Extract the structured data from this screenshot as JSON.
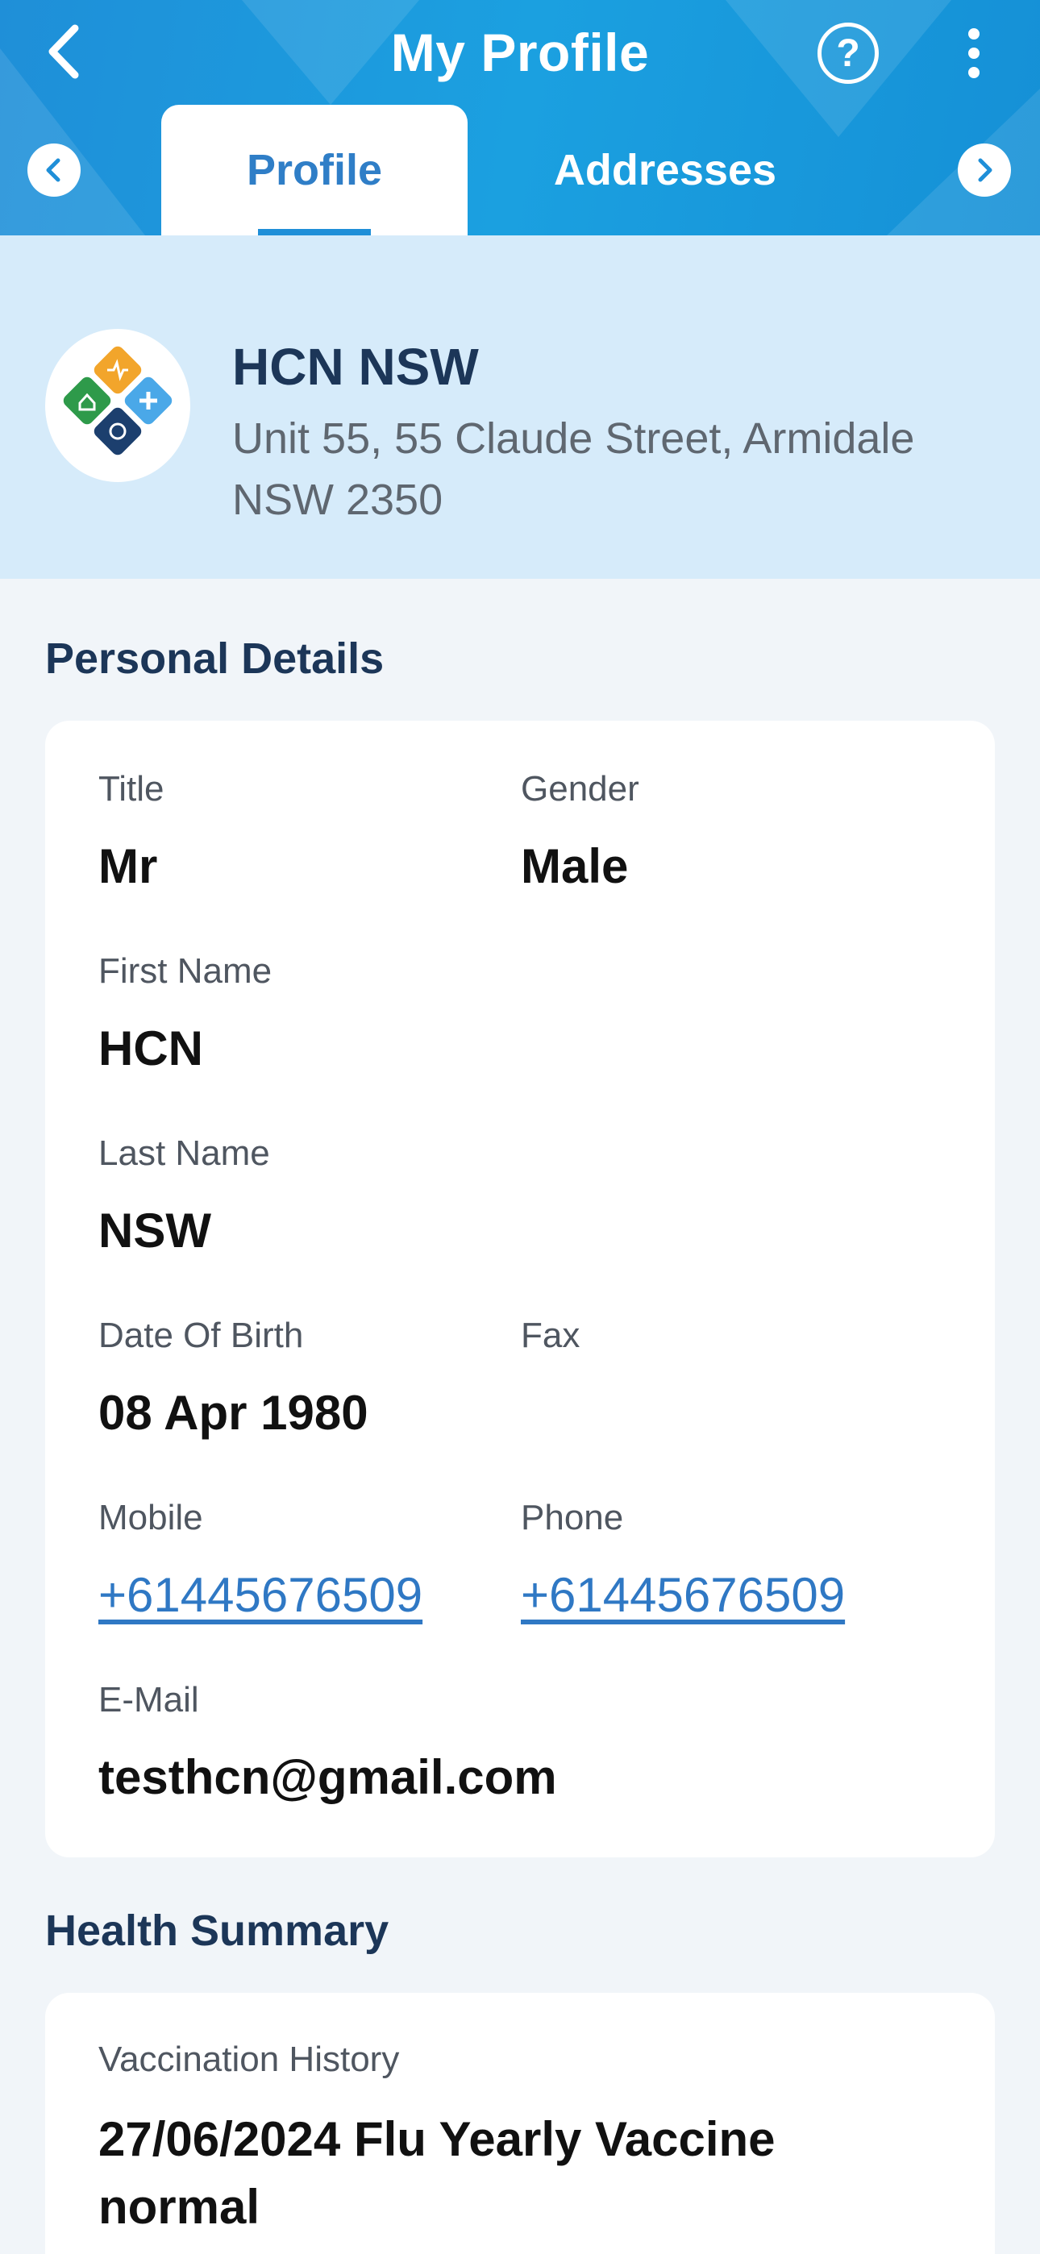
{
  "header": {
    "title": "My Profile",
    "help_label": "?",
    "tabs": [
      {
        "label": "Profile",
        "active": true
      },
      {
        "label": "Addresses",
        "active": false
      }
    ]
  },
  "icons": {
    "back": "chevron-left-icon",
    "help": "help-circle-icon",
    "more": "more-vertical-icon",
    "tab_prev": "chevron-left-icon",
    "tab_next": "chevron-right-icon"
  },
  "organisation": {
    "name": "HCN NSW",
    "address": "Unit 55, 55 Claude Street, Armidale NSW 2350"
  },
  "personal_details": {
    "section_title": "Personal Details",
    "title": {
      "label": "Title",
      "value": "Mr"
    },
    "gender": {
      "label": "Gender",
      "value": "Male"
    },
    "first_name": {
      "label": "First Name",
      "value": "HCN"
    },
    "last_name": {
      "label": "Last Name",
      "value": "NSW"
    },
    "dob": {
      "label": "Date Of Birth",
      "value": "08 Apr 1980"
    },
    "fax": {
      "label": "Fax",
      "value": ""
    },
    "mobile": {
      "label": "Mobile",
      "value": "+61445676509"
    },
    "phone": {
      "label": "Phone",
      "value": "+61445676509"
    },
    "email": {
      "label": "E-Mail",
      "value": "testhcn@gmail.com"
    }
  },
  "health_summary": {
    "section_title": "Health Summary",
    "vaccination": {
      "label": "Vaccination History",
      "value": "27/06/2024 Flu Yearly Vaccine normal"
    }
  },
  "colors": {
    "header_blue": "#1ba0e0",
    "banner_blue": "#d6ebfa",
    "navy_text": "#1c3658",
    "link_blue": "#2f78c4",
    "background": "#f1f5f9"
  }
}
